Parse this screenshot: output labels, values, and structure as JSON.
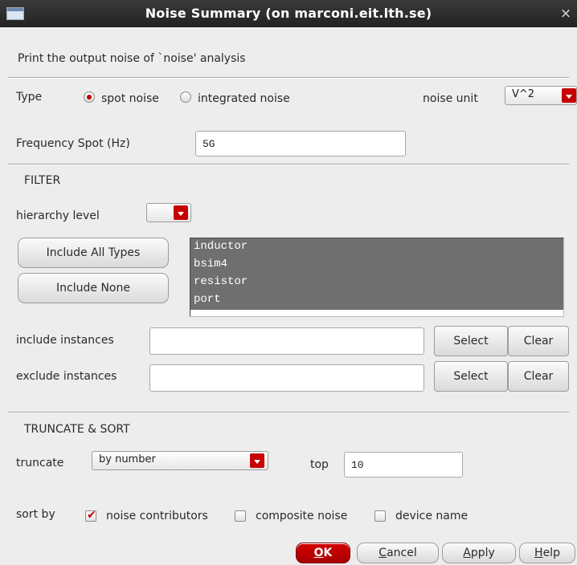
{
  "window": {
    "title": "Noise Summary (on marconi.eit.lth.se)",
    "close_glyph": "×"
  },
  "description": "Print the output noise of `noise' analysis",
  "type": {
    "label": "Type",
    "options": [
      "spot noise",
      "integrated noise"
    ],
    "selected": "spot noise"
  },
  "noise_unit": {
    "label": "noise unit",
    "value": "V^2"
  },
  "frequency_spot": {
    "label": "Frequency Spot (Hz)",
    "value": "5G"
  },
  "filter": {
    "section_label": "FILTER",
    "hierarchy_level_label": "hierarchy level",
    "hierarchy_level_value": "",
    "include_all_types_label": "Include All Types",
    "include_none_label": "Include None",
    "types": [
      "inductor",
      "bsim4",
      "resistor",
      "port"
    ],
    "include_instances": {
      "label": "include instances",
      "value": "",
      "select_label": "Select",
      "clear_label": "Clear"
    },
    "exclude_instances": {
      "label": "exclude instances",
      "value": "",
      "select_label": "Select",
      "clear_label": "Clear"
    }
  },
  "truncate_sort": {
    "section_label": "TRUNCATE & SORT",
    "truncate_label": "truncate",
    "truncate_value": "by number",
    "top_label": "top",
    "top_value": "10",
    "sort_by_label": "sort by",
    "sort_options": [
      {
        "label": "noise contributors",
        "checked": true
      },
      {
        "label": "composite noise",
        "checked": false
      },
      {
        "label": "device name",
        "checked": false
      }
    ]
  },
  "buttons": {
    "ok": {
      "mnemonic": "O",
      "rest": "K"
    },
    "cancel": {
      "mnemonic": "C",
      "rest": "ancel"
    },
    "apply": {
      "mnemonic": "A",
      "rest": "pply"
    },
    "help": {
      "mnemonic": "H",
      "rest": "elp"
    }
  },
  "colors": {
    "accent_red": "#c70000",
    "list_selection": "#6f6f6f",
    "titlebar": "#2a2a2a"
  }
}
